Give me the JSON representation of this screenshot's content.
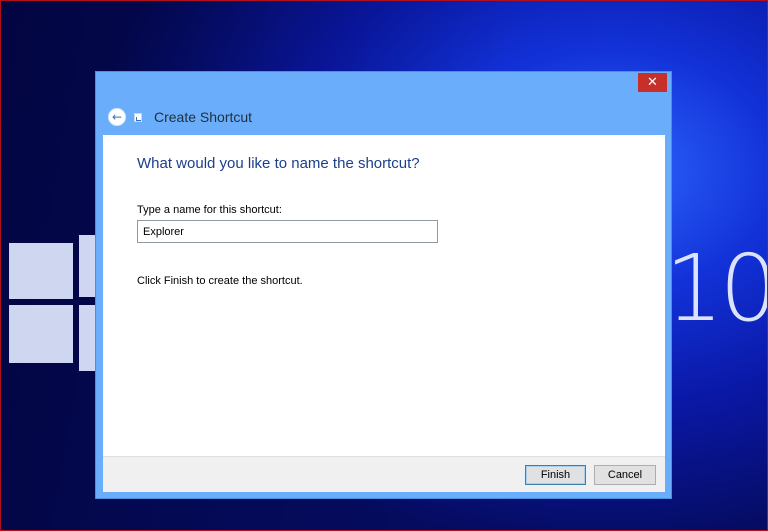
{
  "dialog": {
    "title": "Create Shortcut",
    "close_glyph": "✕",
    "back_glyph": "←",
    "question": "What would you like to name the shortcut?",
    "field_label": "Type a name for this shortcut:",
    "name_value": "Explorer",
    "finish_hint": "Click Finish to create the shortcut.",
    "buttons": {
      "finish": "Finish",
      "cancel": "Cancel"
    }
  },
  "background": {
    "brand_number": "10"
  },
  "icons": [
    "back-arrow-icon",
    "shortcut-icon",
    "close-icon",
    "windows-logo-icon"
  ],
  "colors": {
    "dialog_frame": "#6aaefb",
    "close_button": "#c7302a",
    "heading_text": "#1b3f8a",
    "desktop_blue": "#1232d8"
  }
}
